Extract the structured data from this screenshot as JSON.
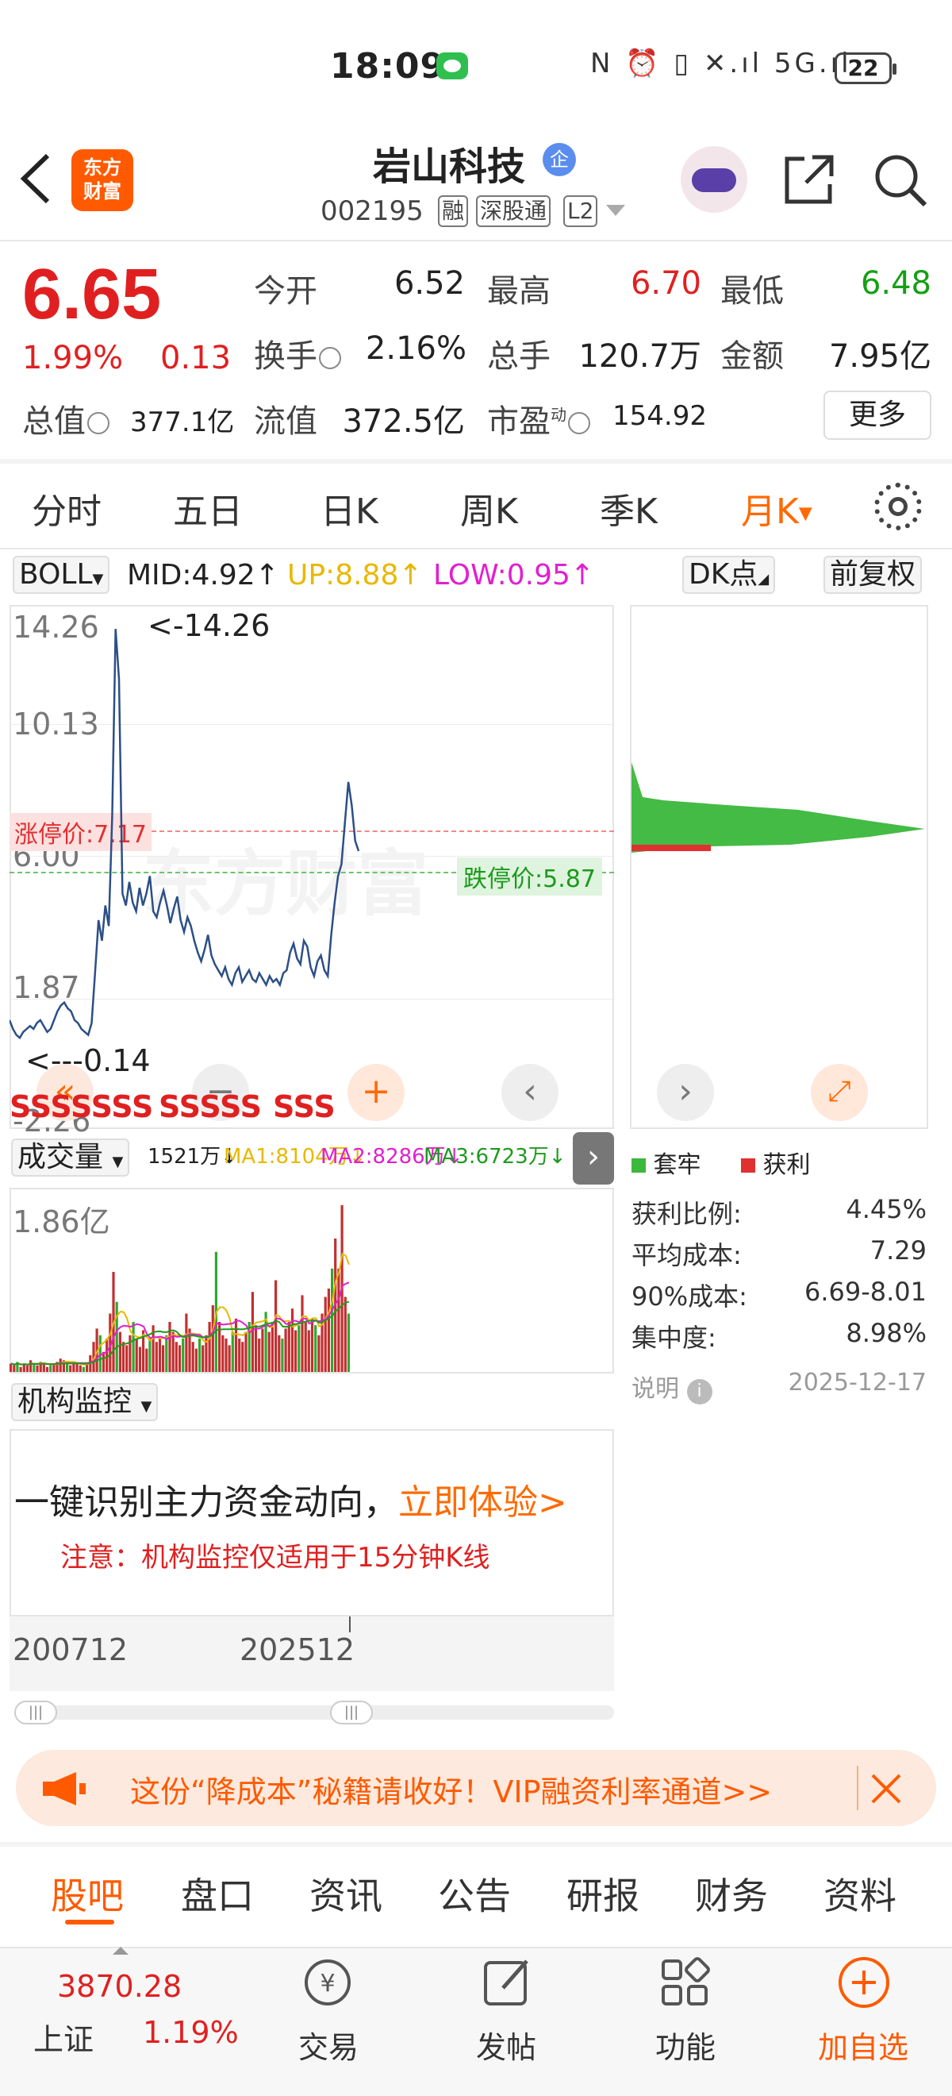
{
  "status_bar": {
    "time": "18:09",
    "battery": "22",
    "icons": "N ⏰ ▯ ✕.ıl 5G.ıl"
  },
  "header": {
    "logo_line1": "东方",
    "logo_line2": "财富",
    "stock_name": "岩山科技",
    "badge": "企",
    "code": "002195",
    "tags": [
      "融",
      "深股通",
      "L2"
    ]
  },
  "quote": {
    "price": "6.65",
    "change_pct": "1.99%",
    "change": "0.13",
    "open_label": "今开",
    "open": "6.52",
    "high_label": "最高",
    "high": "6.70",
    "low_label": "最低",
    "low": "6.48",
    "turnover_label": "换手",
    "turnover": "2.16%",
    "volume_label": "总手",
    "volume": "120.7万",
    "amount_label": "金额",
    "amount": "7.95亿",
    "mktcap_label": "总值",
    "mktcap": "377.1亿",
    "float_label": "流值",
    "float": "372.5亿",
    "pe_label": "市盈",
    "pe_sup": "动",
    "pe": "154.92",
    "more": "更多"
  },
  "period_tabs": [
    "分时",
    "五日",
    "日K",
    "周K",
    "季K",
    "月K"
  ],
  "active_period": "月K",
  "boll": {
    "name": "BOLL",
    "mid": "MID:4.92↑",
    "up": "UP:8.88↑",
    "low": "LOW:0.95↑",
    "mid_color": "#222222",
    "up_color": "#e8b800",
    "low_color": "#e020d0"
  },
  "dk_label": "DK点",
  "adjust_label": "前复权",
  "price_chart": {
    "axis": [
      "14.26",
      "10.13",
      "6.00",
      "1.87",
      "-2.26"
    ],
    "max_label": "<-14.26",
    "min_label": "<---0.14",
    "limit_up": "涨停价:7.17",
    "limit_down": "跌停价:5.87",
    "watermark": "东方财富",
    "sss_marks": [
      "SSSSSSS",
      "SSSSS",
      "SSS"
    ]
  },
  "chart_data": {
    "type": "line",
    "title": "",
    "xlabel": "",
    "ylabel": "",
    "ylim": [
      -2.26,
      14.26
    ],
    "x_range": [
      "200712",
      "202512"
    ],
    "values": [
      0.9,
      0.6,
      0.4,
      0.3,
      0.5,
      0.6,
      0.7,
      0.6,
      0.8,
      0.9,
      0.7,
      0.5,
      0.6,
      0.9,
      1.2,
      1.4,
      1.5,
      1.3,
      1.2,
      0.9,
      0.8,
      0.6,
      0.5,
      0.4,
      0.8,
      2.5,
      4.3,
      3.6,
      4.8,
      4.1,
      7.8,
      14.2,
      12.5,
      5.2,
      4.8,
      5.6,
      4.9,
      4.6,
      5.4,
      4.8,
      5.2,
      5.8,
      4.6,
      4.4,
      4.9,
      5.3,
      4.8,
      4.2,
      4.7,
      5.1,
      4.3,
      3.9,
      4.4,
      4.1,
      3.6,
      3.2,
      2.9,
      3.3,
      3.8,
      3.1,
      2.8,
      2.6,
      2.4,
      2.7,
      2.3,
      2.1,
      2.5,
      2.7,
      2.2,
      2.4,
      2.6,
      2.3,
      2.2,
      2.5,
      2.3,
      2.1,
      2.4,
      2.2,
      2.3,
      2.1,
      2.5,
      2.6,
      3.2,
      3.5,
      3.0,
      2.8,
      3.6,
      3.4,
      2.7,
      2.4,
      2.9,
      3.1,
      2.6,
      2.4,
      3.8,
      4.9,
      5.8,
      6.2,
      7.6,
      9.0,
      8.2,
      7.0,
      6.65
    ]
  },
  "distribution": {
    "legend_trapped": "套牢",
    "legend_profit": "获利",
    "trapped_color": "#3cb83c",
    "profit_color": "#e03030",
    "stats": [
      {
        "label": "获利比例:",
        "value": "4.45%"
      },
      {
        "label": "平均成本:",
        "value": "7.29"
      },
      {
        "label": "90%成本:",
        "value": "6.69-8.01"
      },
      {
        "label": "集中度:",
        "value": "8.98%"
      }
    ],
    "note_label": "说明",
    "date": "2025-12-17"
  },
  "volume": {
    "name": "成交量",
    "vol": "1521万↓",
    "ma1": "MA1:8104万↓",
    "ma2": "MA2:8286万↓",
    "ma3": "MA3:6723万↓",
    "max_label": "1.86亿",
    "bars": [
      0.05,
      0.04,
      0.06,
      0.03,
      0.05,
      0.04,
      0.07,
      0.05,
      0.04,
      0.06,
      0.05,
      0.03,
      0.04,
      0.05,
      0.06,
      0.08,
      0.07,
      0.05,
      0.04,
      0.06,
      0.05,
      0.04,
      0.03,
      0.05,
      0.1,
      0.18,
      0.26,
      0.22,
      0.12,
      0.2,
      0.35,
      0.6,
      0.42,
      0.24,
      0.18,
      0.16,
      0.22,
      0.3,
      0.2,
      0.15,
      0.25,
      0.14,
      0.2,
      0.28,
      0.18,
      0.2,
      0.16,
      0.22,
      0.3,
      0.24,
      0.18,
      0.16,
      0.2,
      0.35,
      0.26,
      0.18,
      0.14,
      0.2,
      0.16,
      0.22,
      0.3,
      0.4,
      0.72,
      0.3,
      0.22,
      0.2,
      0.16,
      0.24,
      0.32,
      0.2,
      0.18,
      0.24,
      0.3,
      0.48,
      0.28,
      0.2,
      0.26,
      0.36,
      0.24,
      0.3,
      0.55,
      0.22,
      0.2,
      0.26,
      0.3,
      0.38,
      0.25,
      0.28,
      0.46,
      0.3,
      0.25,
      0.32,
      0.28,
      0.22,
      0.35,
      0.45,
      0.5,
      0.62,
      0.8,
      0.62,
      1.0,
      0.45,
      0.35
    ]
  },
  "institution": {
    "title": "机构监控",
    "main_text": "一键识别主力资金动向，",
    "cta": "立即体验>",
    "note": "注意：机构监控仅适用于15分钟K线"
  },
  "time_axis": {
    "start": "200712",
    "end": "202512"
  },
  "ad": {
    "text": "这份“降成本”秘籍请收好！VIP融资利率通道>>"
  },
  "bottom_tabs": [
    "股吧",
    "盘口",
    "资讯",
    "公告",
    "研报",
    "财务",
    "资料"
  ],
  "active_bottom_tab": "股吧",
  "bottom_nav": {
    "index_value": "3870.28",
    "index_name": "上证",
    "index_pct": "1.19%",
    "items": [
      "交易",
      "发帖",
      "功能",
      "加自选"
    ]
  }
}
